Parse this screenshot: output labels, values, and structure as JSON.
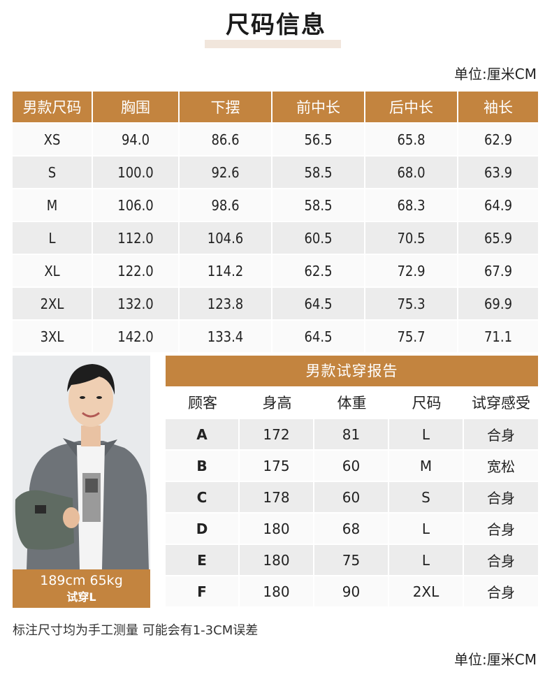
{
  "title": "尺码信息",
  "unit_label": "单位:厘米CM",
  "size_table": {
    "headers": [
      "男款尺码",
      "胸围",
      "下摆",
      "前中长",
      "后中长",
      "袖长"
    ],
    "rows": [
      [
        "XS",
        "94.0",
        "86.6",
        "56.5",
        "65.8",
        "62.9"
      ],
      [
        "S",
        "100.0",
        "92.6",
        "58.5",
        "68.0",
        "63.9"
      ],
      [
        "M",
        "106.0",
        "98.6",
        "58.5",
        "68.3",
        "64.9"
      ],
      [
        "L",
        "112.0",
        "104.6",
        "60.5",
        "70.5",
        "65.9"
      ],
      [
        "XL",
        "122.0",
        "114.2",
        "62.5",
        "72.9",
        "67.9"
      ],
      [
        "2XL",
        "132.0",
        "123.8",
        "64.5",
        "75.3",
        "69.9"
      ],
      [
        "3XL",
        "142.0",
        "133.4",
        "64.5",
        "75.7",
        "71.1"
      ]
    ]
  },
  "model": {
    "stats": "189cm 65kg",
    "tryon": "试穿L"
  },
  "fit_report": {
    "title": "男款试穿报告",
    "headers": [
      "顾客",
      "身高",
      "体重",
      "尺码",
      "试穿感受"
    ],
    "rows": [
      [
        "A",
        "172",
        "81",
        "L",
        "合身"
      ],
      [
        "B",
        "175",
        "60",
        "M",
        "宽松"
      ],
      [
        "C",
        "178",
        "60",
        "S",
        "合身"
      ],
      [
        "D",
        "180",
        "68",
        "L",
        "合身"
      ],
      [
        "E",
        "180",
        "75",
        "L",
        "合身"
      ],
      [
        "F",
        "180",
        "90",
        "2XL",
        "合身"
      ]
    ]
  },
  "note": "标注尺寸均为手工测量 可能会有1-3CM误差",
  "colors": {
    "accent": "#c3843f",
    "row_light": "#fafafa",
    "row_dark": "#ececec",
    "title_bar": "#f1e6dc"
  }
}
